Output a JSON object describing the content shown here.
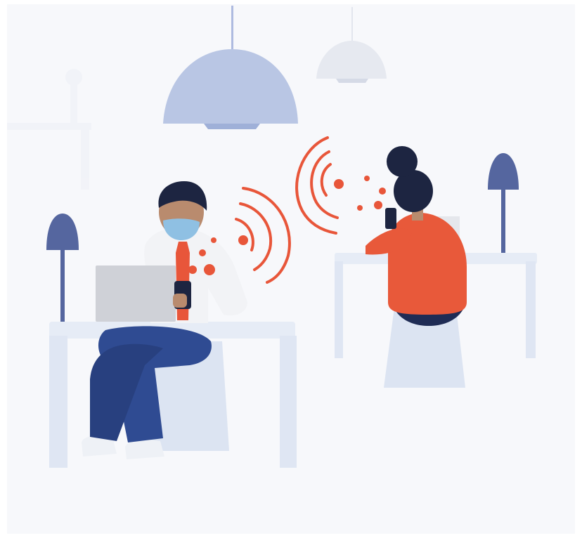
{
  "scene": {
    "description_visible_text": "",
    "colors": {
      "background": "#f7f8fb",
      "lamp_shade": "#b9c6e4",
      "lamp_shade_light": "#dfe4ee",
      "desk": "#e6ecf6",
      "desk_shadow": "#c9d4ea",
      "desk_lamp": "#55669f",
      "signal_orange": "#e8563a",
      "skin": "#b98b6e",
      "hair_dark": "#1d2541",
      "mask": "#8fc0e3",
      "shirt_white": "#f2f3f6",
      "tie_orange": "#e8563a",
      "pants_blue": "#2f4b92",
      "shoe": "#eef1f6",
      "laptop": "#cfd1d7",
      "sweater_orange": "#e8593a",
      "pants_navy": "#1f2c55",
      "stool": "#dce4f2"
    },
    "icons": {
      "signal": "wireless-signal-icon",
      "pendant_lamp": "pendant-lamp-icon",
      "desk_lamp": "desk-lamp-icon"
    }
  }
}
